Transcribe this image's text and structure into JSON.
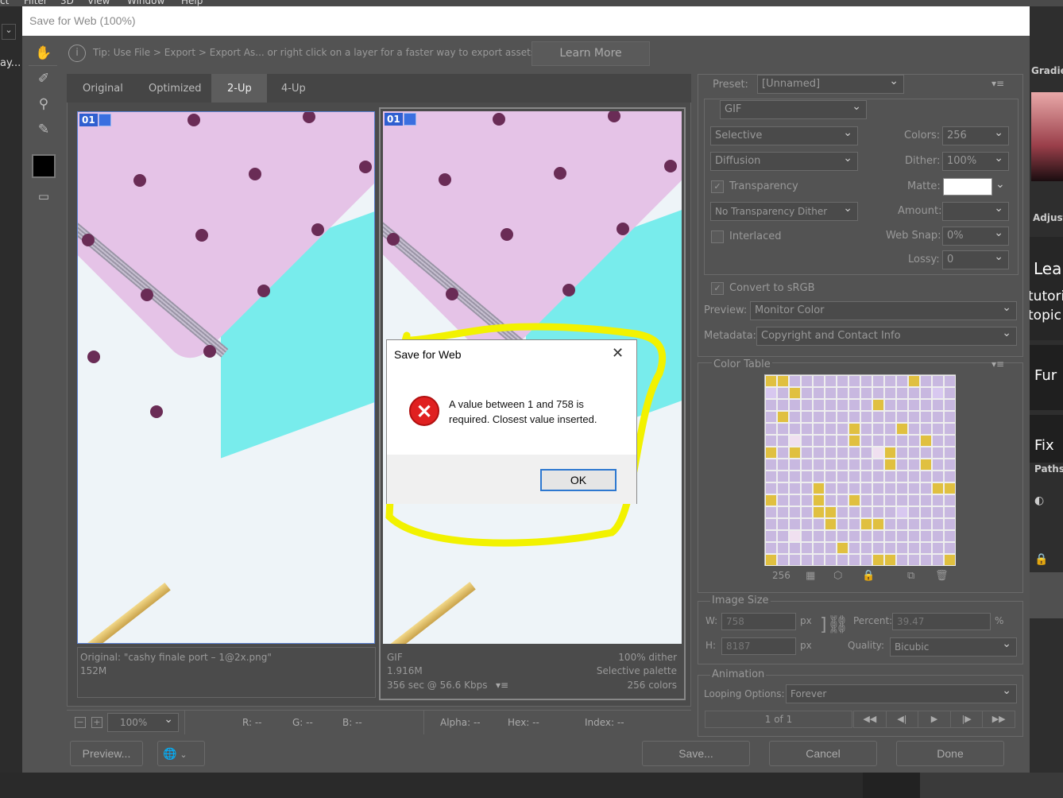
{
  "background_app": {
    "menu_items": [
      "ct",
      "Filter",
      "3D",
      "View",
      "Window",
      "Help"
    ],
    "left_label": "ay...",
    "right_panel": {
      "gradient_tab": "Gradie",
      "adjust_tab": "Adjust",
      "learn_heading": "Lear",
      "learn_line1": "tutori",
      "learn_line2": "topic",
      "fun_label": "Fur",
      "fix_label": "Fix",
      "paths_tab": "Paths"
    }
  },
  "dialog": {
    "title": "Save for Web (100%)",
    "tip": "Tip: Use File > Export > Export As...  or right click on a layer for a faster way to export assets",
    "learn_more": "Learn More",
    "tabs": [
      "Original",
      "Optimized",
      "2-Up",
      "4-Up"
    ],
    "active_tab": "2-Up",
    "pane_badge": "01",
    "original_info": {
      "line1": "Original: \"cashy finale port – 1@2x.png\"",
      "line2": "152M"
    },
    "optimized_info": {
      "format": "GIF",
      "size": "1.916M",
      "time": "356 sec @ 56.6 Kbps",
      "dither": "100% dither",
      "palette": "Selective palette",
      "colors": "256 colors"
    },
    "status": {
      "zoom": "100%",
      "r": "R: --",
      "g": "G: --",
      "b": "B: --",
      "alpha": "Alpha: --",
      "hex": "Hex: --",
      "index": "Index: --"
    },
    "buttons": {
      "preview": "Preview...",
      "save": "Save...",
      "cancel": "Cancel",
      "done": "Done"
    }
  },
  "settings": {
    "preset_label": "Preset:",
    "preset_value": "[Unnamed]",
    "format": "GIF",
    "reduction": "Selective",
    "dither_algo": "Diffusion",
    "transparency_label": "Transparency",
    "transparency_dither": "No Transparency Dither",
    "interlaced_label": "Interlaced",
    "colors_label": "Colors:",
    "colors_value": "256",
    "dither_label": "Dither:",
    "dither_value": "100%",
    "matte_label": "Matte:",
    "amount_label": "Amount:",
    "amount_value": "",
    "websnap_label": "Web Snap:",
    "websnap_value": "0%",
    "lossy_label": "Lossy:",
    "lossy_value": "0",
    "convert_label": "Convert to sRGB",
    "preview_label": "Preview:",
    "preview_value": "Monitor Color",
    "metadata_label": "Metadata:",
    "metadata_value": "Copyright and Contact Info",
    "color_table_label": "Color Table",
    "color_count": "256",
    "image_size_label": "Image Size",
    "w_label": "W:",
    "w_value": "758",
    "h_label": "H:",
    "h_value": "8187",
    "px": "px",
    "percent_label": "Percent:",
    "percent_value": "39.47",
    "percent_unit": "%",
    "quality_label": "Quality:",
    "quality_value": "Bicubic",
    "animation_label": "Animation",
    "looping_label": "Looping Options:",
    "looping_value": "Forever",
    "frame_counter": "1 of 1"
  },
  "alert": {
    "title": "Save for Web",
    "message_line1": "A value between 1 and 758 is",
    "message_line2": "required. Closest value inserted.",
    "ok": "OK"
  },
  "colors": {
    "accent_badge": "#2f5fd0",
    "highlight": "#f2f200",
    "error_red": "#e02020"
  }
}
